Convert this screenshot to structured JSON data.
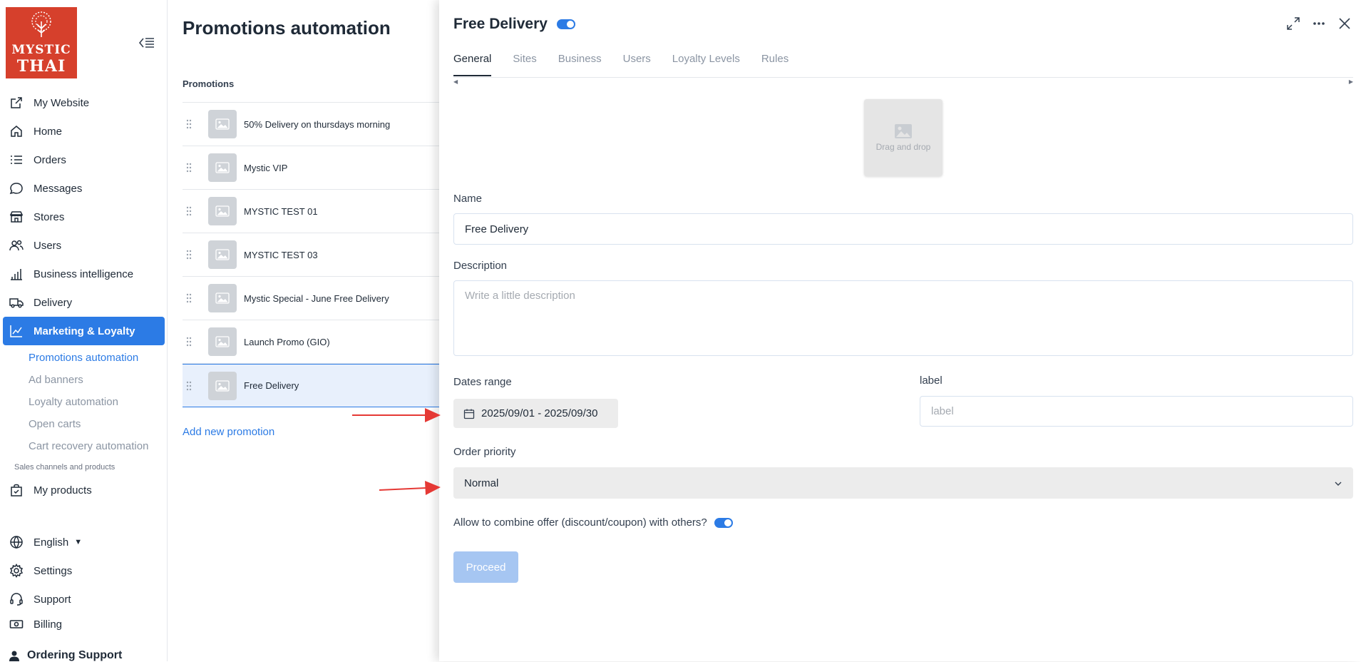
{
  "brand": {
    "logo_line1": "MYSTIC",
    "logo_line2": "THAI",
    "logo_color": "#d6402c"
  },
  "sidebar": {
    "items": [
      {
        "label": "My Website",
        "icon": "external-link-icon"
      },
      {
        "label": "Home",
        "icon": "home-icon"
      },
      {
        "label": "Orders",
        "icon": "list-icon"
      },
      {
        "label": "Messages",
        "icon": "chat-icon"
      },
      {
        "label": "Stores",
        "icon": "store-icon"
      },
      {
        "label": "Users",
        "icon": "users-icon"
      },
      {
        "label": "Business intelligence",
        "icon": "bar-chart-icon"
      },
      {
        "label": "Delivery",
        "icon": "truck-icon"
      },
      {
        "label": "Marketing & Loyalty",
        "icon": "trend-chart-icon"
      }
    ],
    "sub_items": [
      {
        "label": "Promotions automation"
      },
      {
        "label": "Ad banners"
      },
      {
        "label": "Loyalty automation"
      },
      {
        "label": "Open carts"
      },
      {
        "label": "Cart recovery automation"
      }
    ],
    "section_label": "Sales channels and products",
    "products_label": "My products",
    "language": "English",
    "settings": "Settings",
    "support": "Support",
    "billing": "Billing",
    "ordering_support": "Ordering Support"
  },
  "promotions": {
    "title": "Promotions automation",
    "header": "Promotions",
    "rows": [
      {
        "label": "50% Delivery on thursdays morning"
      },
      {
        "label": "Mystic VIP"
      },
      {
        "label": "MYSTIC TEST 01"
      },
      {
        "label": "MYSTIC TEST 03"
      },
      {
        "label": "Mystic Special - June Free Delivery"
      },
      {
        "label": "Launch Promo (GIO)"
      },
      {
        "label": "Free Delivery"
      }
    ],
    "add_label": "Add new promotion"
  },
  "drawer": {
    "title": "Free Delivery",
    "enabled": true,
    "tabs": [
      {
        "label": "General"
      },
      {
        "label": "Sites"
      },
      {
        "label": "Business"
      },
      {
        "label": "Users"
      },
      {
        "label": "Loyalty Levels"
      },
      {
        "label": "Rules"
      }
    ],
    "dropzone_text": "Drag and drop",
    "name_label": "Name",
    "name_value": "Free Delivery",
    "description_label": "Description",
    "description_placeholder": "Write a little description",
    "dates_label": "Dates range",
    "dates_value": "2025/09/01 - 2025/09/30",
    "label_label": "label",
    "label_placeholder": "label",
    "priority_label": "Order priority",
    "priority_value": "Normal",
    "combine_label": "Allow to combine offer (discount/coupon) with others?",
    "combine_enabled": true,
    "proceed_label": "Proceed"
  },
  "colors": {
    "accent": "#2c7be5",
    "annotation_arrow": "#e53935",
    "proceed_disabled": "#a6c6f2"
  }
}
